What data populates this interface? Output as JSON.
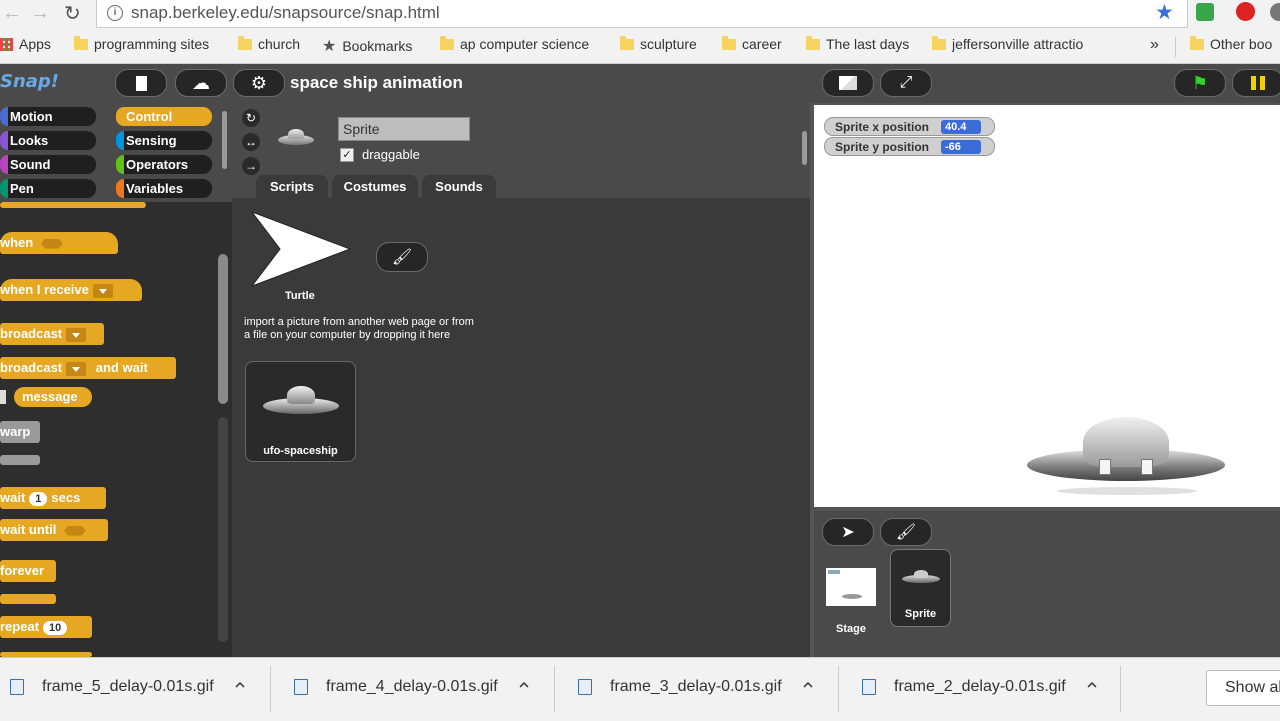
{
  "browser": {
    "url": "snap.berkeley.edu/snapsource/snap.html",
    "bookmarks": [
      {
        "label": "Apps"
      },
      {
        "label": "programming sites"
      },
      {
        "label": "church"
      },
      {
        "label": "Bookmarks"
      },
      {
        "label": "ap computer science"
      },
      {
        "label": "sculpture"
      },
      {
        "label": "career"
      },
      {
        "label": "The last days"
      },
      {
        "label": "jeffersonville attractio"
      },
      {
        "label": "Other boo"
      }
    ],
    "more_label": "»"
  },
  "snap": {
    "logo": "Snap!",
    "project_title": "space ship animation",
    "categories": [
      {
        "label": "Motion",
        "color": "#4a6cd4"
      },
      {
        "label": "Control",
        "color": "#e6a822"
      },
      {
        "label": "Looks",
        "color": "#8a55d7"
      },
      {
        "label": "Sensing",
        "color": "#0494dc"
      },
      {
        "label": "Sound",
        "color": "#bb42c3"
      },
      {
        "label": "Operators",
        "color": "#62c213"
      },
      {
        "label": "Pen",
        "color": "#009870"
      },
      {
        "label": "Variables",
        "color": "#f3761d"
      }
    ],
    "blocks": {
      "when": "when",
      "when_receive": "when I receive",
      "broadcast": "broadcast",
      "broadcast_wait": "broadcast",
      "and_wait": "and wait",
      "message": "message",
      "warp": "warp",
      "wait": "wait",
      "wait_value": "1",
      "secs": "secs",
      "wait_until": "wait until",
      "forever": "forever",
      "repeat": "repeat",
      "repeat_value": "10"
    },
    "sprite": {
      "name": "Sprite",
      "draggable_label": "draggable",
      "tabs": [
        "Scripts",
        "Costumes",
        "Sounds"
      ],
      "active_tab": "Costumes"
    },
    "costumes": {
      "turtle_label": "Turtle",
      "import_hint_line1": "import a picture from another web page or from",
      "import_hint_line2": "a file on your computer by dropping it here",
      "items": [
        {
          "label": "ufo-spaceship"
        }
      ]
    },
    "watchers": [
      {
        "label": "Sprite x position",
        "value": "40.4"
      },
      {
        "label": "Sprite y position",
        "value": "-66"
      }
    ],
    "corral": [
      {
        "label": "Stage"
      },
      {
        "label": "Sprite"
      }
    ]
  },
  "downloads": {
    "items": [
      {
        "label": "frame_5_delay-0.01s.gif"
      },
      {
        "label": "frame_4_delay-0.01s.gif"
      },
      {
        "label": "frame_3_delay-0.01s.gif"
      },
      {
        "label": "frame_2_delay-0.01s.gif"
      }
    ],
    "show_all": "Show al"
  }
}
